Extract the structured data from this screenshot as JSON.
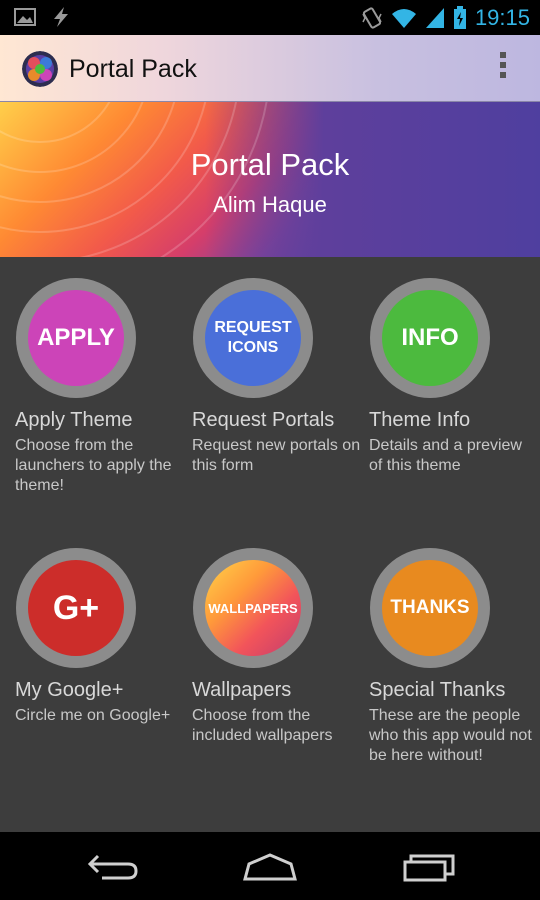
{
  "status_bar": {
    "time": "19:15"
  },
  "action_bar": {
    "title": "Portal Pack"
  },
  "banner": {
    "title": "Portal Pack",
    "author": "Alim Haque"
  },
  "tiles": [
    {
      "badge": "APPLY",
      "title": "Apply Theme",
      "desc": "Choose from the launchers to apply the theme!",
      "color": "#cc44b8"
    },
    {
      "badge_line1": "REQUEST",
      "badge_line2": "ICONS",
      "title": "Request Portals",
      "desc": "Request new portals on this form",
      "color": "#4a6fd9"
    },
    {
      "badge": "INFO",
      "title": "Theme Info",
      "desc": "Details and a preview of this theme",
      "color": "#4cba3e"
    },
    {
      "badge": "G+",
      "title": "My Google+",
      "desc": "Circle me on Google+",
      "color": "#cc2d2a"
    },
    {
      "badge": "WALLPAPERS",
      "title": "Wallpapers",
      "desc": "Choose from the included wallpapers",
      "color": "#e85a6a"
    },
    {
      "badge": "THANKS",
      "title": "Special Thanks",
      "desc": "These are the people who this app would not be here without!",
      "color": "#e88a1f"
    }
  ],
  "icons": [
    "image-icon",
    "charging-bolt-icon",
    "vibrate-icon",
    "wifi-icon",
    "signal-icon",
    "battery-icon",
    "app-logo-icon",
    "overflow-menu-icon",
    "back-icon",
    "home-icon",
    "recents-icon"
  ]
}
